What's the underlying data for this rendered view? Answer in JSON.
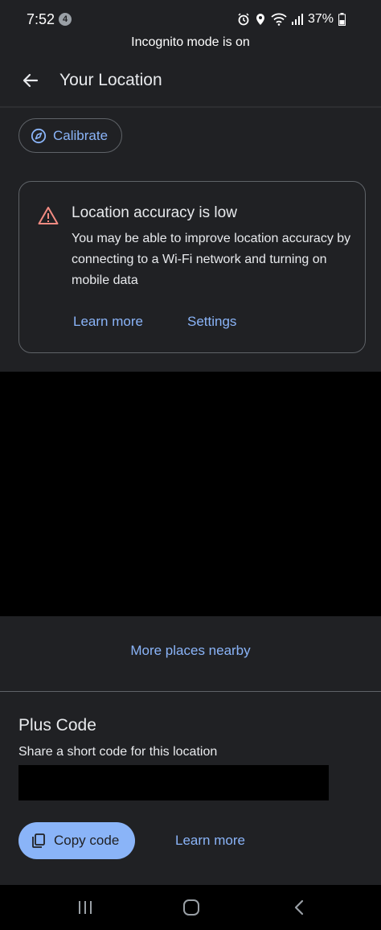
{
  "status_bar": {
    "time": "7:52",
    "notification_count": "4",
    "battery": "37%",
    "icons": [
      "alarm-icon",
      "location-pin-icon",
      "wifi-icon",
      "signal-icon",
      "battery-icon"
    ]
  },
  "incognito_banner": "Incognito mode is on",
  "app_bar": {
    "title": "Your Location",
    "back_icon": "arrow-left-icon"
  },
  "calibrate": {
    "label": "Calibrate",
    "icon": "compass-icon"
  },
  "accuracy_card": {
    "title": "Location accuracy is low",
    "body": "You may be able to improve location accuracy by connecting to a Wi-Fi network and turning on mobile data",
    "learn_more": "Learn more",
    "settings": "Settings",
    "icon": "warning-icon"
  },
  "more_places": "More places nearby",
  "plus_code": {
    "title": "Plus Code",
    "subtitle": "Share a short code for this location",
    "copy_label": "Copy code",
    "learn_more": "Learn more",
    "copy_icon": "copy-icon"
  },
  "nav_bar": {
    "icons": [
      "recent-apps-icon",
      "home-icon",
      "back-icon"
    ]
  },
  "colors": {
    "background": "#202124",
    "accent": "#8ab4f8",
    "warning": "#f28b82",
    "text": "#e8eaed"
  }
}
